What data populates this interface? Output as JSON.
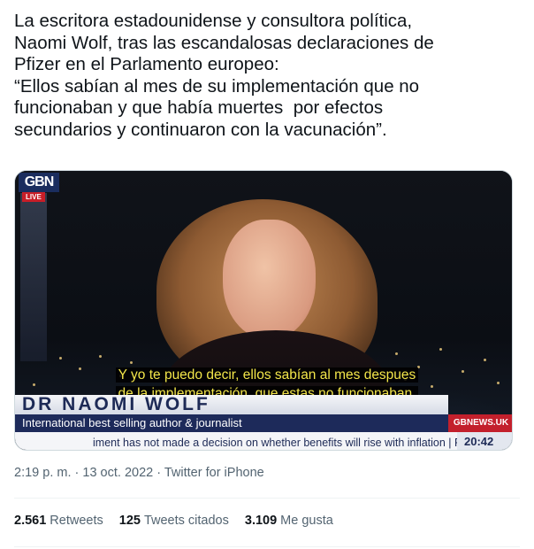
{
  "tweet": {
    "lines": [
      "La escritora estadounidense y consultora política,",
      "Naomi Wolf, tras las escandalosas declaraciones de",
      "Pfizer en el Parlamento europeo:",
      "“Ellos sabían al mes de su implementación que no",
      "funcionaban y que había muertes  por efectos",
      "secundarios y continuaron con la vacunación”."
    ]
  },
  "media": {
    "channel_logo": "GBN",
    "live_badge": "LIVE",
    "subtitle_lines": [
      "Y yo te puedo decir, ellos sabían al mes despues",
      "de la implementación, que estas no funcionaban."
    ],
    "lower_third": {
      "name": "DR NAOMI WOLF",
      "role": "International best selling author & journalist",
      "network_tag": "GBNEWS.UK",
      "ticker": "iment has not made a decision on whether benefits will rise with inflation | F",
      "clock": "20:42"
    }
  },
  "meta": {
    "time": "2:19 p. m.",
    "separator": "·",
    "date": "13 oct. 2022",
    "source": "Twitter for iPhone"
  },
  "stats": {
    "retweets_count": "2.561",
    "retweets_label": "Retweets",
    "quotes_count": "125",
    "quotes_label": "Tweets citados",
    "likes_count": "3.109",
    "likes_label": "Me gusta"
  }
}
